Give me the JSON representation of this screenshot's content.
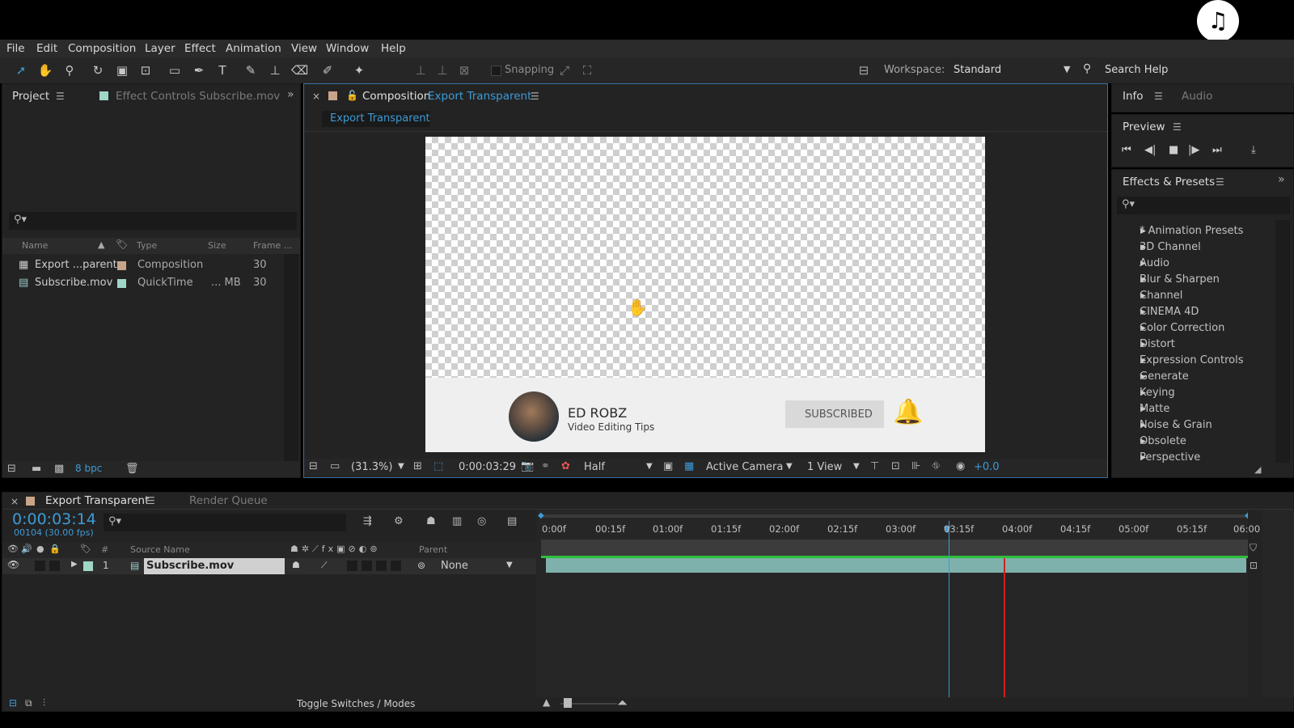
{
  "menu": [
    "File",
    "Edit",
    "Composition",
    "Layer",
    "Effect",
    "Animation",
    "View",
    "Window",
    "Help"
  ],
  "toolbar": {
    "snapping_label": "Snapping",
    "workspace_label": "Workspace:",
    "workspace_value": "Standard",
    "search_help": "Search Help"
  },
  "project_panel": {
    "tab_project": "Project",
    "tab_effect_controls": "Effect Controls Subscribe.mov",
    "columns": {
      "name": "Name",
      "type": "Type",
      "size": "Size",
      "frame": "Frame ..."
    },
    "items": [
      {
        "name": "Export ...parent",
        "type": "Composition",
        "size": "",
        "frame": "30",
        "color": "#c8a48a"
      },
      {
        "name": "Subscribe.mov",
        "type": "QuickTime",
        "size": "... MB",
        "frame": "30",
        "color": "#9fd6c8"
      }
    ],
    "bpc": "8 bpc"
  },
  "composition_panel": {
    "tab_prefix": "Composition",
    "tab_name": "Export Transparent",
    "breadcrumb": "Export Transparent",
    "zoom": "(31.3%)",
    "timecode": "0:00:03:29",
    "resolution": "Half",
    "camera": "Active Camera",
    "views": "1 View",
    "exposure": "+0.0"
  },
  "overlay": {
    "channel": "ED ROBZ",
    "subtitle": "Video Editing Tips",
    "button": "SUBSCRIBED"
  },
  "info_panel": {
    "tab_info": "Info",
    "tab_audio": "Audio",
    "preview_title": "Preview"
  },
  "effects_panel": {
    "title": "Effects & Presets",
    "items": [
      "* Animation Presets",
      "3D Channel",
      "Audio",
      "Blur & Sharpen",
      "Channel",
      "CINEMA 4D",
      "Color Correction",
      "Distort",
      "Expression Controls",
      "Generate",
      "Keying",
      "Matte",
      "Noise & Grain",
      "Obsolete",
      "Perspective"
    ]
  },
  "timeline": {
    "tab_comp": "Export Transparent",
    "tab_render": "Render Queue",
    "current_time": "0:00:03:14",
    "frame_info": "00104 (30.00 fps)",
    "col_source": "Source Name",
    "col_parent": "Parent",
    "layer": {
      "index": "1",
      "name": "Subscribe.mov",
      "parent": "None"
    },
    "ruler": [
      "0:00f",
      "00:15f",
      "01:00f",
      "01:15f",
      "02:00f",
      "02:15f",
      "03:00f",
      "03:15f",
      "04:00f",
      "04:15f",
      "05:00f",
      "05:15f",
      "06:00"
    ],
    "toggle": "Toggle Switches / Modes"
  },
  "colors": {
    "accent": "#3d9bd6",
    "layer_bar": "#7fb1ac",
    "playhead": "#3d9bd6",
    "cti_red": "#d02020"
  }
}
